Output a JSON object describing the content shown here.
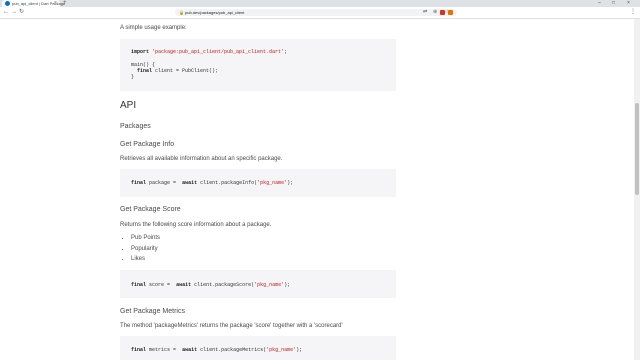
{
  "browser": {
    "tab_title": "pub_api_client | Dart Package",
    "url": "pub.dev/packages/pub_api_client"
  },
  "intro": "A simple usage example:",
  "example_code": {
    "line1_kw": "import",
    "line1_str": "'package:pub_api_client/pub_api_client.dart'",
    "line1_end": ";",
    "line2": "main() {",
    "line3_kw": "final",
    "line3_rest": "client = PubClient();",
    "line4": "}"
  },
  "api_heading": "API",
  "packages_heading": "Packages",
  "package_info": {
    "heading": "Get Package Info",
    "description": "Retrieves all available information about an specific package.",
    "code_kw1": "final",
    "code_mid": "package =",
    "code_kw2": "await",
    "code_call": "client.packageInfo(",
    "code_str": "'pkg_name'",
    "code_end": ");"
  },
  "package_score": {
    "heading": "Get Package Score",
    "description": "Returns the following score information about a package.",
    "bullets": [
      "Pub Points",
      "Popularity",
      "Likes"
    ],
    "code_kw1": "final",
    "code_mid": "score =",
    "code_kw2": "await",
    "code_call": "client.packageScore(",
    "code_str": "'pkg_name'",
    "code_end": ");"
  },
  "package_metrics": {
    "heading": "Get Package Metrics",
    "description": "The method 'packageMetrics' returns the package 'score' together with a 'scorecard'",
    "code_kw1": "final",
    "code_mid": "metrics =",
    "code_kw2": "await",
    "code_call": "client.packageMetrics(",
    "code_str": "'pkg_name'",
    "code_end": ");"
  }
}
